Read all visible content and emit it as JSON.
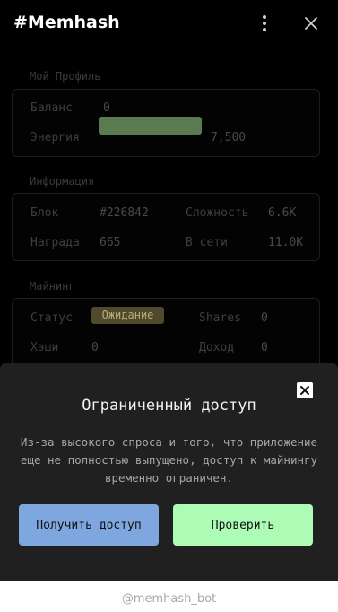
{
  "header": {
    "title": "#Memhash",
    "menu_icon": "vertical-dots-icon",
    "close_icon": "close-icon"
  },
  "profile": {
    "section_title": "Мой Профиль",
    "balance_label": "Баланс",
    "balance_value": "0",
    "energy_label": "Энергия",
    "energy_value": "7,500",
    "energy_fill": 1.0
  },
  "info": {
    "section_title": "Информация",
    "block_label": "Блок",
    "block_value": "#226842",
    "difficulty_label": "Сложность",
    "difficulty_value": "6.6K",
    "reward_label": "Награда",
    "reward_value": "665",
    "online_label": "В сети",
    "online_value": "11.0K"
  },
  "mining": {
    "section_title": "Майнинг",
    "status_label": "Статус",
    "status_value": "Ожидание",
    "shares_label": "Shares",
    "shares_value": "0",
    "hashes_label": "Хэши",
    "hashes_value": "0",
    "income_label": "Доход",
    "income_value": "0"
  },
  "modal": {
    "title": "Ограниченный доступ",
    "text": "Из-за высокого спроса и того, что приложение еще не полностью выпущено, доступ к майнингу временно ограничен.",
    "access_button": "Получить доступ",
    "check_button": "Проверить"
  },
  "footer": {
    "bot_name": "@memhash_bot"
  },
  "colors": {
    "background": "#000000",
    "modal_bg": "#202020",
    "energy_bar": "#4e6b47",
    "status_badge": "#4f4a2b",
    "access_button": "#7ea6df",
    "check_button": "#adfcb6"
  }
}
